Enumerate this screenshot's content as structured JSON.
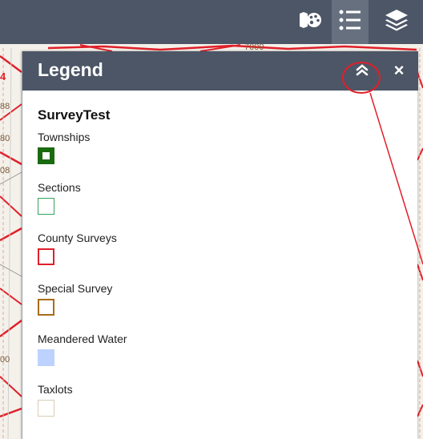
{
  "map": {
    "labels": [
      "7000",
      "4",
      "88",
      "80",
      "08",
      "00"
    ]
  },
  "toolbar": {
    "tools": [
      {
        "name": "basemap",
        "icon": "basemap-gallery-icon"
      },
      {
        "name": "legend",
        "icon": "legend-list-icon",
        "active": true
      },
      {
        "name": "layers",
        "icon": "layers-icon"
      }
    ]
  },
  "legend_panel": {
    "title": "Legend",
    "collapse_icon": "double-chevron-up-icon",
    "close_glyph": "×",
    "layer_title": "SurveyTest",
    "items": [
      {
        "label": "Townships",
        "color": "#1a6b10",
        "style": "thick-outline"
      },
      {
        "label": "Sections",
        "color": "#38a35a",
        "style": "outline"
      },
      {
        "label": "County Surveys",
        "color": "#e0202a",
        "style": "outline"
      },
      {
        "label": "Special Survey",
        "color": "#a86d1a",
        "style": "outline"
      },
      {
        "label": "Meandered Water",
        "color": "#bed2ff",
        "style": "fill"
      },
      {
        "label": "Taxlots",
        "color": "#d9cdb6",
        "style": "outline"
      }
    ]
  },
  "annotation": {
    "color": "#e0202a"
  }
}
